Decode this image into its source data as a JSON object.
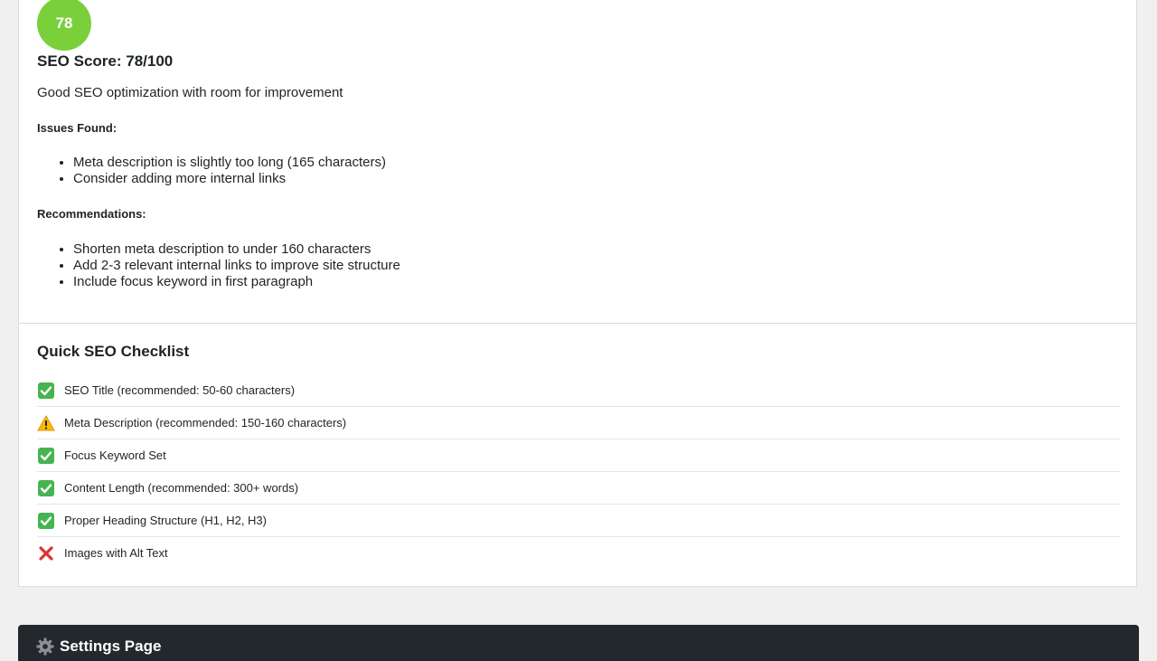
{
  "seo_score": {
    "score": "78",
    "title": "SEO Score: 78/100",
    "summary": "Good SEO optimization with room for improvement",
    "circle_color": "#7ad03a"
  },
  "issues": {
    "label": "Issues Found:",
    "items": [
      "Meta description is slightly too long (165 characters)",
      "Consider adding more internal links"
    ]
  },
  "recommendations": {
    "label": "Recommendations:",
    "items": [
      "Shorten meta description to under 160 characters",
      "Add 2-3 relevant internal links to improve site structure",
      "Include focus keyword in first paragraph"
    ]
  },
  "checklist": {
    "title": "Quick SEO Checklist",
    "items": [
      {
        "status": "pass",
        "icon": "check-icon",
        "label": "SEO Title (recommended: 50-60 characters)"
      },
      {
        "status": "warning",
        "icon": "warning-icon",
        "label": "Meta Description (recommended: 150-160 characters)"
      },
      {
        "status": "pass",
        "icon": "check-icon",
        "label": "Focus Keyword Set"
      },
      {
        "status": "pass",
        "icon": "check-icon",
        "label": "Content Length (recommended: 300+ words)"
      },
      {
        "status": "pass",
        "icon": "check-icon",
        "label": "Proper Heading Structure (H1, H2, H3)"
      },
      {
        "status": "fail",
        "icon": "cross-icon",
        "label": "Images with Alt Text"
      }
    ],
    "colors": {
      "pass": "#46b450",
      "warning": "#ffb900",
      "fail": "#dc3232"
    }
  },
  "settings": {
    "title": "Settings Page",
    "icon": "gear-icon"
  }
}
